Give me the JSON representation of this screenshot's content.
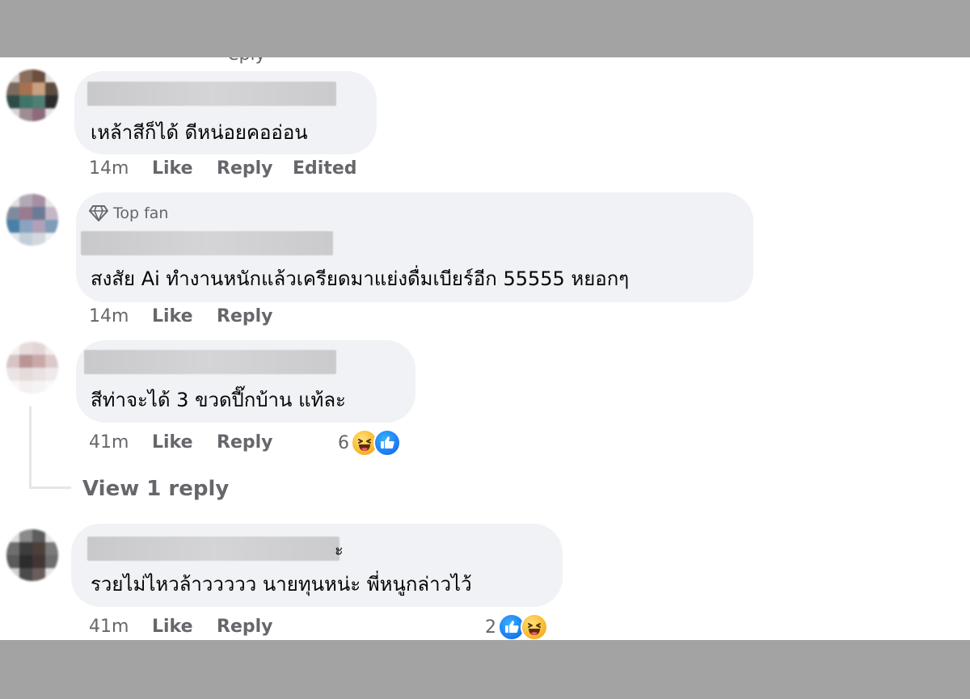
{
  "fragment_top": "eply",
  "comments": [
    {
      "top_fan": "",
      "text": "เหล้าสีก็ได้ ดีหน่อยคออ่อน",
      "time": "14m",
      "like": "Like",
      "reply": "Reply",
      "edited": "Edited",
      "reaction_count": ""
    },
    {
      "top_fan": "Top fan",
      "text": "สงสัย Ai ทำงานหนักแล้วเครียดมาแย่งดื่มเบียร์อีก 55555 หยอกๆ",
      "time": "14m",
      "like": "Like",
      "reply": "Reply",
      "edited": "",
      "reaction_count": ""
    },
    {
      "top_fan": "",
      "text": "สีท่าจะได้ 3 ขวดปี๊กบ้าน แท้ละ",
      "time": "41m",
      "like": "Like",
      "reply": "Reply",
      "edited": "",
      "reaction_count": "6",
      "reactions": [
        "haha-icon",
        "like-icon"
      ]
    },
    {
      "top_fan": "",
      "text": "รวยไม่ไหวล้าววววว นายทุนหน่ะ พี่หนูกล่าวไว้",
      "time": "41m",
      "like": "Like",
      "reply": "Reply",
      "edited": "",
      "reaction_count": "2",
      "reactions": [
        "like-icon",
        "haha-icon"
      ],
      "name_tail": "ะ"
    }
  ],
  "view_replies": "View 1 reply",
  "colors": {
    "bubble": "#f0f2f5",
    "meta_text": "#65676b",
    "like_blue": "#1877f2",
    "haha_yellow": "#f7b125",
    "frame_gray": "#a3a3a3"
  }
}
